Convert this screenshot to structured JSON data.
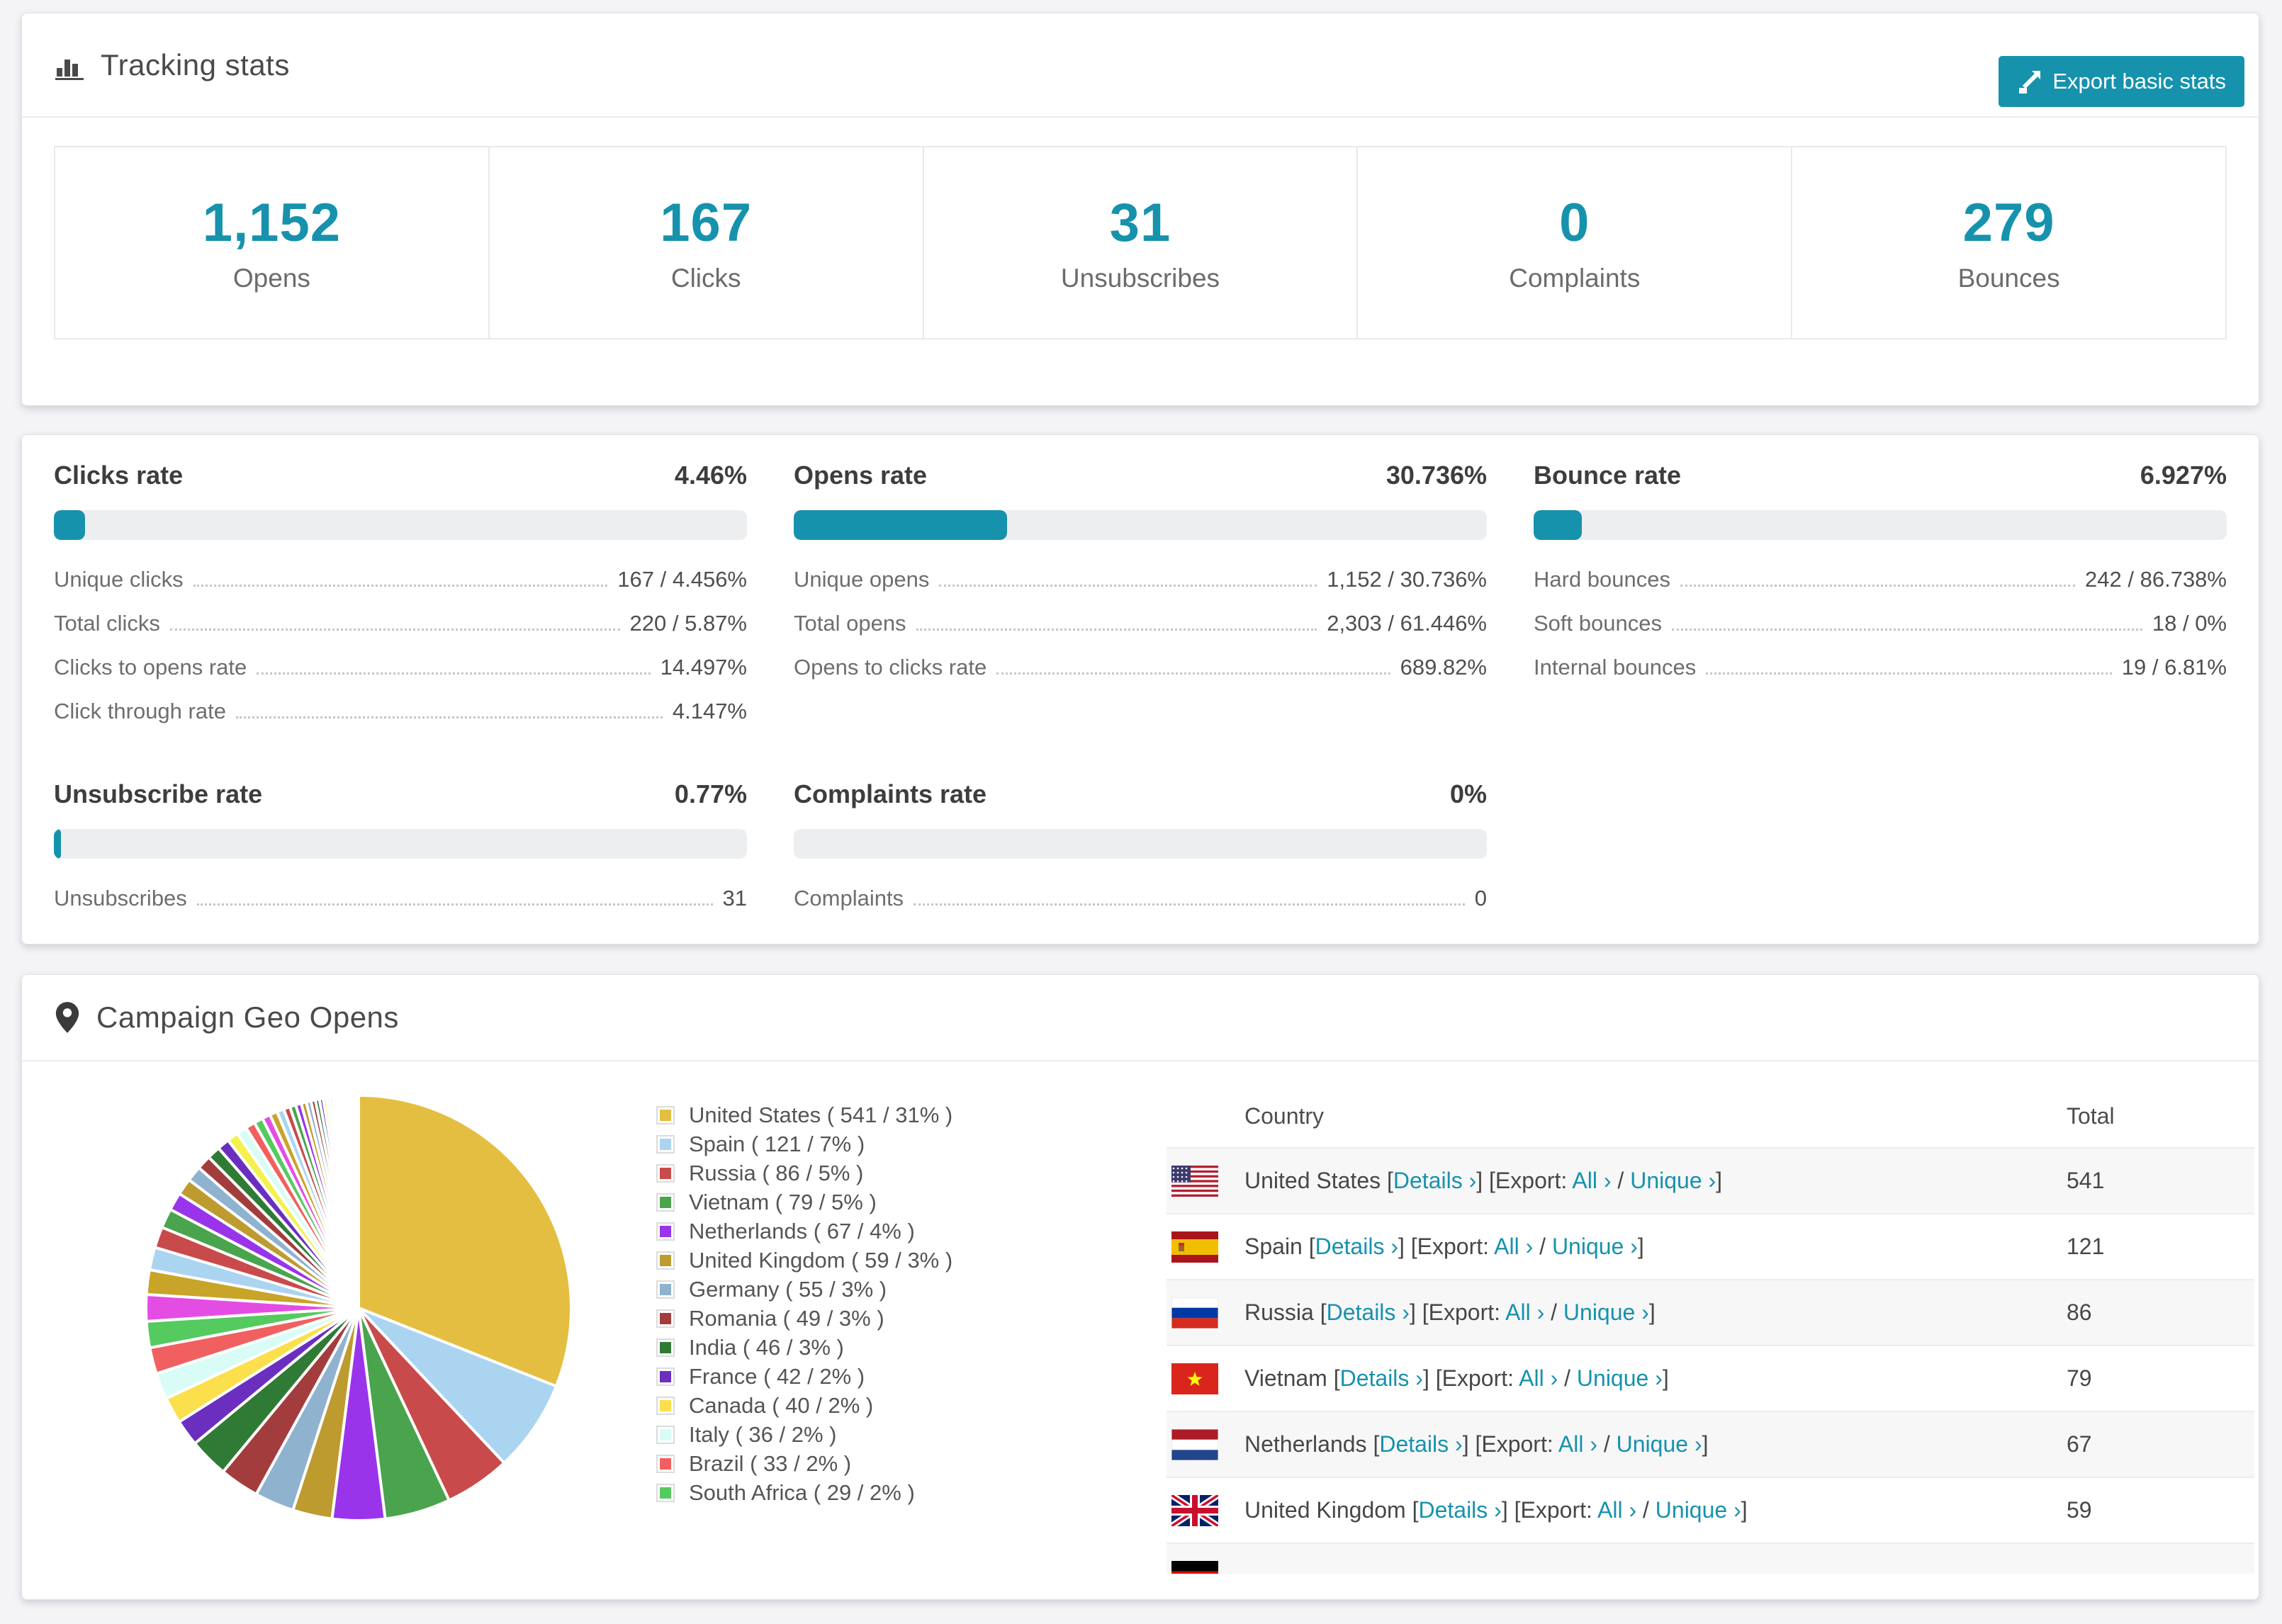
{
  "colors": {
    "accent": "#1692ad"
  },
  "tracking": {
    "title": "Tracking stats",
    "export_label": "Export basic stats",
    "stats": [
      {
        "value": "1,152",
        "label": "Opens"
      },
      {
        "value": "167",
        "label": "Clicks"
      },
      {
        "value": "31",
        "label": "Unsubscribes"
      },
      {
        "value": "0",
        "label": "Complaints"
      },
      {
        "value": "279",
        "label": "Bounces"
      }
    ]
  },
  "rates": [
    {
      "title": "Clicks rate",
      "value": "4.46%",
      "percent": 4.46,
      "rows": [
        {
          "label": "Unique clicks",
          "value": "167 / 4.456%"
        },
        {
          "label": "Total clicks",
          "value": "220 / 5.87%"
        },
        {
          "label": "Clicks to opens rate",
          "value": "14.497%"
        },
        {
          "label": "Click through rate",
          "value": "4.147%"
        }
      ]
    },
    {
      "title": "Opens rate",
      "value": "30.736%",
      "percent": 30.736,
      "rows": [
        {
          "label": "Unique opens",
          "value": "1,152 / 30.736%"
        },
        {
          "label": "Total opens",
          "value": "2,303 / 61.446%"
        },
        {
          "label": "Opens to clicks rate",
          "value": "689.82%"
        }
      ]
    },
    {
      "title": "Bounce rate",
      "value": "6.927%",
      "percent": 6.927,
      "rows": [
        {
          "label": "Hard bounces",
          "value": "242 / 86.738%"
        },
        {
          "label": "Soft bounces",
          "value": "18 / 0%"
        },
        {
          "label": "Internal bounces",
          "value": "19 / 6.81%"
        }
      ]
    },
    {
      "title": "Unsubscribe rate",
      "value": "0.77%",
      "percent": 0.77,
      "rows": [
        {
          "label": "Unsubscribes",
          "value": "31"
        }
      ]
    },
    {
      "title": "Complaints rate",
      "value": "0%",
      "percent": 0,
      "rows": [
        {
          "label": "Complaints",
          "value": "0"
        }
      ]
    }
  ],
  "geo": {
    "title": "Campaign Geo Opens",
    "chart_data": {
      "type": "pie",
      "title": "Campaign Geo Opens",
      "legend_position": "right",
      "start_angle": "12 o'clock, clockwise",
      "series": [
        {
          "name": "United States",
          "value": 541,
          "percent": 31,
          "color": "#E4BE40",
          "legend": "United States ( 541 / 31% )"
        },
        {
          "name": "Spain",
          "value": 121,
          "percent": 7,
          "color": "#ABD4F1",
          "legend": "Spain ( 121 / 7% )"
        },
        {
          "name": "Russia",
          "value": 86,
          "percent": 5,
          "color": "#C94A4A",
          "legend": "Russia ( 86 / 5% )"
        },
        {
          "name": "Vietnam",
          "value": 79,
          "percent": 5,
          "color": "#4AA44D",
          "legend": "Vietnam ( 79 / 5% )"
        },
        {
          "name": "Netherlands",
          "value": 67,
          "percent": 4,
          "color": "#9934EB",
          "legend": "Netherlands ( 67 / 4% )"
        },
        {
          "name": "United Kingdom",
          "value": 59,
          "percent": 3,
          "color": "#BE9B2F",
          "legend": "United Kingdom ( 59 / 3% )"
        },
        {
          "name": "Germany",
          "value": 55,
          "percent": 3,
          "color": "#8FB2CF",
          "legend": "Germany ( 55 / 3% )"
        },
        {
          "name": "Romania",
          "value": 49,
          "percent": 3,
          "color": "#A33D3D",
          "legend": "Romania ( 49 / 3% )"
        },
        {
          "name": "India",
          "value": 46,
          "percent": 3,
          "color": "#2F7B36",
          "legend": "India ( 46 / 3% )"
        },
        {
          "name": "France",
          "value": 42,
          "percent": 2,
          "color": "#6B2FC0",
          "legend": "France ( 42 / 2% )"
        },
        {
          "name": "Canada",
          "value": 40,
          "percent": 2,
          "color": "#FBDF4D",
          "legend": "Canada ( 40 / 2% )"
        },
        {
          "name": "Italy",
          "value": 36,
          "percent": 2,
          "color": "#D9FCF6",
          "legend": "Italy ( 36 / 2% )"
        },
        {
          "name": "Brazil",
          "value": 33,
          "percent": 2,
          "color": "#F16060",
          "legend": "Brazil ( 33 / 2% )"
        },
        {
          "name": "South Africa",
          "value": 29,
          "percent": 2,
          "color": "#55CA5E",
          "legend": "South Africa ( 29 / 2% )"
        }
      ],
      "other_small_slices": {
        "percent_total": 26,
        "note": "long tail of many unlabeled thin slices tapering toward 12 o'clock",
        "palette": [
          "#E44DE4",
          "#C8A428",
          "#ABD4F1",
          "#C94A4A",
          "#4AA44D",
          "#9934EB",
          "#BE9B2F",
          "#8FB2CF",
          "#A33D3D",
          "#2F7B36",
          "#6B2FC0",
          "#F5F04A",
          "#D9FCF6",
          "#F16060",
          "#55CA5E"
        ]
      }
    },
    "table": {
      "country_header": "Country",
      "total_header": "Total",
      "details_label": "Details ›",
      "export_prefix": "[Export:",
      "all_label": "All ›",
      "unique_label": "Unique ›",
      "rows": [
        {
          "country": "United States",
          "total": "541",
          "flag": "us"
        },
        {
          "country": "Spain",
          "total": "121",
          "flag": "es"
        },
        {
          "country": "Russia",
          "total": "86",
          "flag": "ru"
        },
        {
          "country": "Vietnam",
          "total": "79",
          "flag": "vn"
        },
        {
          "country": "Netherlands",
          "total": "67",
          "flag": "nl"
        },
        {
          "country": "United Kingdom",
          "total": "59",
          "flag": "gb"
        },
        {
          "country": "",
          "total": "",
          "flag": "de",
          "partial": true
        }
      ]
    }
  }
}
